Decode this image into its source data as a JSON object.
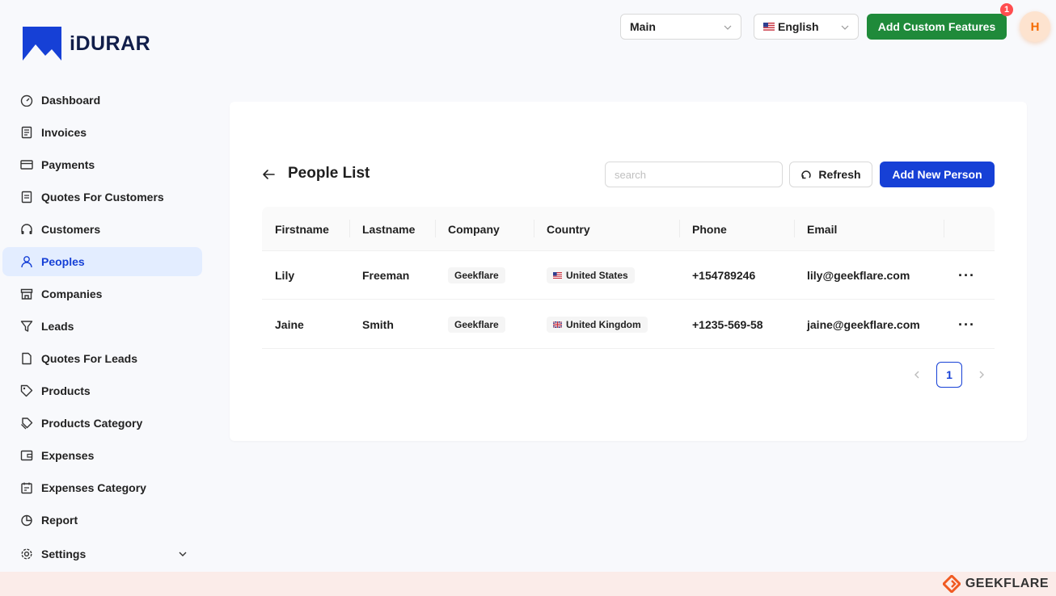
{
  "brand": {
    "name": "iDURAR",
    "accent": "#1640d6"
  },
  "sidebar": {
    "items": [
      {
        "label": "Dashboard",
        "icon": "dashboard-icon"
      },
      {
        "label": "Invoices",
        "icon": "invoice-icon"
      },
      {
        "label": "Payments",
        "icon": "credit-card-icon"
      },
      {
        "label": "Quotes For Customers",
        "icon": "file-sync-icon"
      },
      {
        "label": "Customers",
        "icon": "headphones-icon"
      },
      {
        "label": "Peoples",
        "icon": "user-icon",
        "active": true
      },
      {
        "label": "Companies",
        "icon": "shop-icon"
      },
      {
        "label": "Leads",
        "icon": "filter-icon"
      },
      {
        "label": "Quotes For Leads",
        "icon": "file-icon"
      },
      {
        "label": "Products",
        "icon": "tag-icon"
      },
      {
        "label": "Products Category",
        "icon": "tags-icon"
      },
      {
        "label": "Expenses",
        "icon": "wallet-icon"
      },
      {
        "label": "Expenses Category",
        "icon": "reconciliation-icon"
      },
      {
        "label": "Report",
        "icon": "pie-chart-icon"
      },
      {
        "label": "Settings",
        "icon": "settings-icon"
      }
    ]
  },
  "header": {
    "branch_select": "Main",
    "language_select": "English",
    "add_features_label": "Add Custom Features",
    "notification_count": "1",
    "avatar_initial": "H"
  },
  "main": {
    "title": "People List",
    "search_placeholder": "search",
    "refresh_label": "Refresh",
    "add_label": "Add New Person",
    "columns": [
      "Firstname",
      "Lastname",
      "Company",
      "Country",
      "Phone",
      "Email"
    ],
    "rows": [
      {
        "firstname": "Lily",
        "lastname": "Freeman",
        "company": "Geekflare",
        "country": "United States",
        "phone": "+154789246",
        "email": "lily@geekflare.com"
      },
      {
        "firstname": "Jaine",
        "lastname": "Smith",
        "company": "Geekflare",
        "country": "United Kingdom",
        "phone": "+1235-569-58",
        "email": "jaine@geekflare.com"
      }
    ],
    "row_action": "···",
    "pagination": {
      "current_page": "1"
    }
  },
  "footer": {
    "watermark": "GEEKFLARE"
  }
}
